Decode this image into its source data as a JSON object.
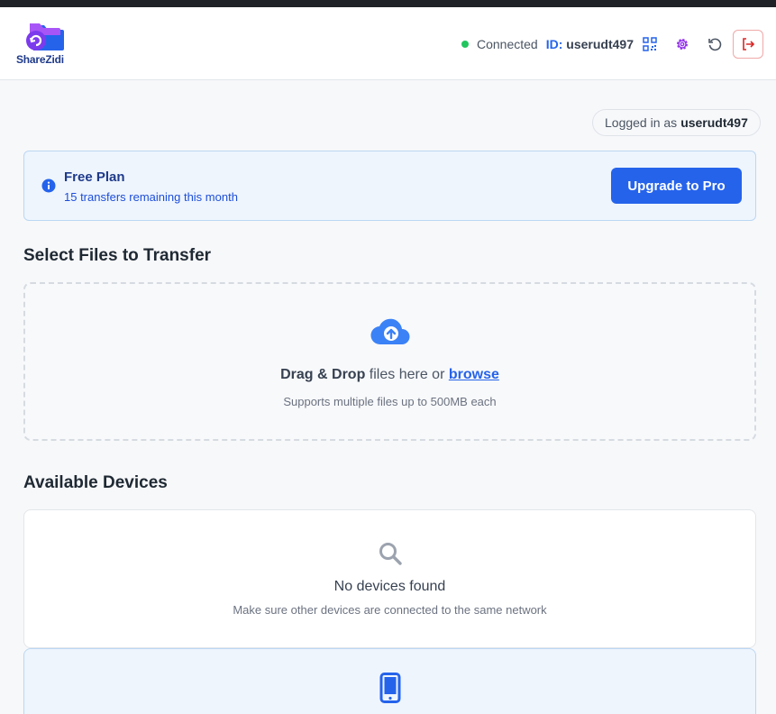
{
  "app": {
    "name": "ShareZidi"
  },
  "header": {
    "status": "Connected",
    "id_label": "ID:",
    "user_id": "userudt497",
    "icons": [
      "qr-code-icon",
      "gear-icon",
      "refresh-icon",
      "logout-icon"
    ]
  },
  "session": {
    "logged_prefix": "Logged in as",
    "username": "userudt497"
  },
  "plan": {
    "title": "Free Plan",
    "subtitle": "15 transfers remaining this month",
    "upgrade_label": "Upgrade to Pro"
  },
  "upload": {
    "section_title": "Select Files to Transfer",
    "bold": "Drag & Drop",
    "text": " files here or ",
    "browse": "browse",
    "hint": "Supports multiple files up to 500MB each"
  },
  "devices": {
    "section_title": "Available Devices",
    "empty_title": "No devices found",
    "empty_hint": "Make sure other devices are connected to the same network"
  },
  "colors": {
    "accent": "#2563eb",
    "connected": "#22c55e",
    "logout": "#dc2626"
  }
}
